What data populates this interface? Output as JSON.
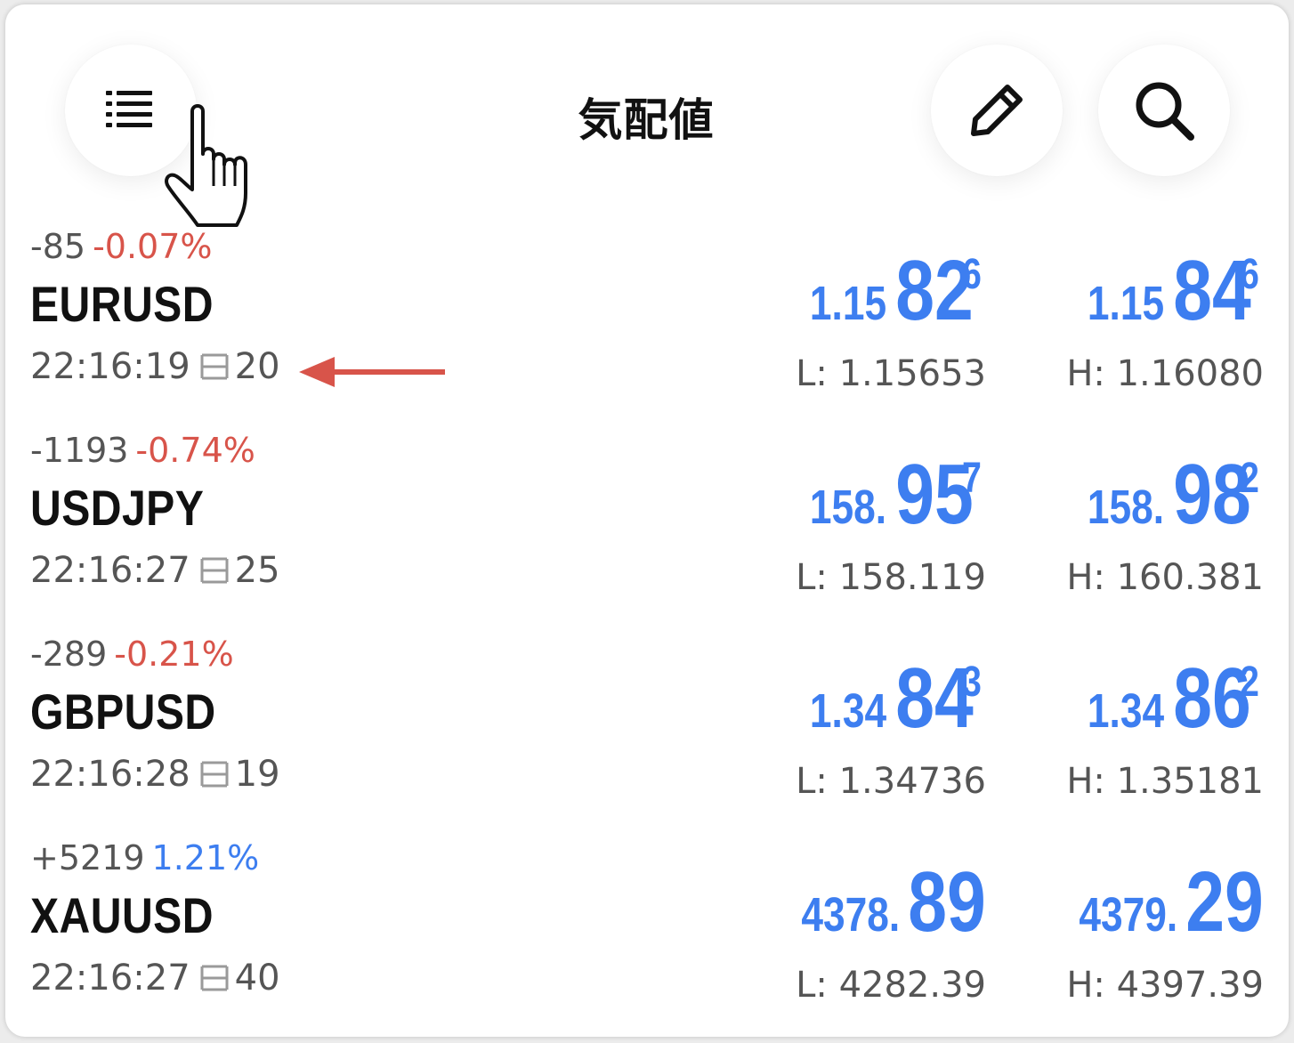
{
  "header": {
    "title": "気配値",
    "menu_icon": "list-icon",
    "edit_icon": "pencil-icon",
    "search_icon": "search-icon"
  },
  "colors": {
    "accent": "#3d7ef0",
    "negative": "#d8544a",
    "annotation_arrow": "#d8544a"
  },
  "quotes": [
    {
      "change_points": "-85",
      "change_pct": "-0.07%",
      "direction": "negative",
      "symbol": "EURUSD",
      "time": "22:16:19",
      "spread": "20",
      "bid": {
        "base": "1.15",
        "big": "82",
        "sup": "6"
      },
      "ask": {
        "base": "1.15",
        "big": "84",
        "sup": "6"
      },
      "low": "L: 1.15653",
      "high": "H: 1.16080"
    },
    {
      "change_points": "-1193",
      "change_pct": "-0.74%",
      "direction": "negative",
      "symbol": "USDJPY",
      "time": "22:16:27",
      "spread": "25",
      "bid": {
        "base": "158.",
        "big": "95",
        "sup": "7"
      },
      "ask": {
        "base": "158.",
        "big": "98",
        "sup": "2"
      },
      "low": "L: 158.119",
      "high": "H: 160.381"
    },
    {
      "change_points": "-289",
      "change_pct": "-0.21%",
      "direction": "negative",
      "symbol": "GBPUSD",
      "time": "22:16:28",
      "spread": "19",
      "bid": {
        "base": "1.34",
        "big": "84",
        "sup": "3"
      },
      "ask": {
        "base": "1.34",
        "big": "86",
        "sup": "2"
      },
      "low": "L: 1.34736",
      "high": "H: 1.35181"
    },
    {
      "change_points": "+5219",
      "change_pct": "1.21%",
      "direction": "positive",
      "symbol": "XAUUSD",
      "time": "22:16:27",
      "spread": "40",
      "bid": {
        "base": "4378.",
        "big": "89",
        "sup": ""
      },
      "ask": {
        "base": "4379.",
        "big": "29",
        "sup": ""
      },
      "low": "L: 4282.39",
      "high": "H: 4397.39"
    }
  ]
}
